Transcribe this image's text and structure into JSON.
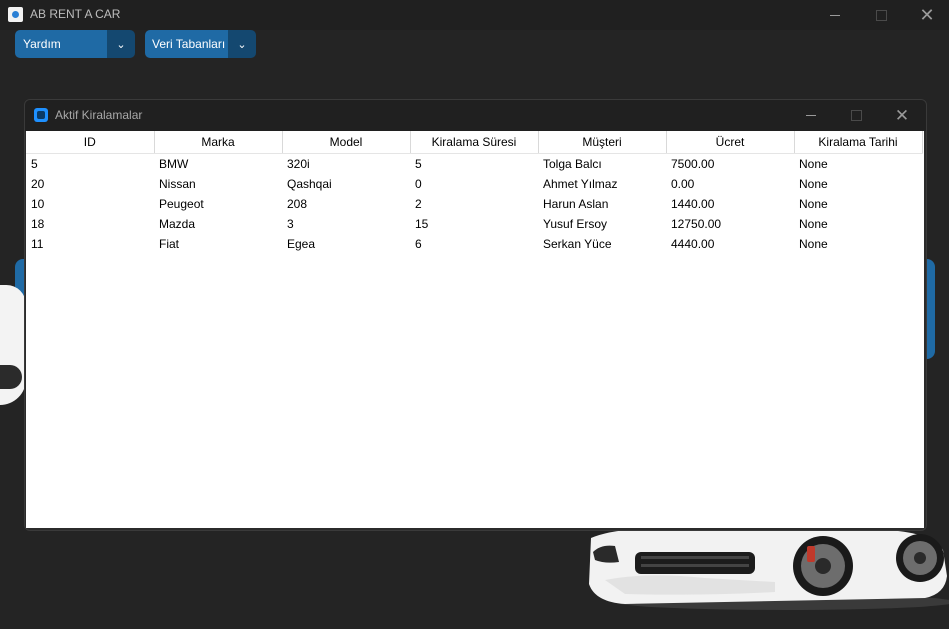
{
  "app": {
    "title": "AB RENT A CAR"
  },
  "menus": [
    {
      "label": "Yardım"
    },
    {
      "label": "Veri Tabanları"
    }
  ],
  "child_window": {
    "title": "Aktif Kiralamalar",
    "table": {
      "columns": [
        "ID",
        "Marka",
        "Model",
        "Kiralama Süresi",
        "Müşteri",
        "Ücret",
        "Kiralama Tarihi"
      ],
      "rows": [
        [
          "5",
          "BMW",
          "320i",
          "5",
          "Tolga Balcı",
          "7500.00",
          "None"
        ],
        [
          "20",
          "Nissan",
          "Qashqai",
          "0",
          "Ahmet Yılmaz",
          "0.00",
          "None"
        ],
        [
          "10",
          "Peugeot",
          "208",
          "2",
          "Harun Aslan",
          "1440.00",
          "None"
        ],
        [
          "18",
          "Mazda",
          "3",
          "15",
          "Yusuf Ersoy",
          "12750.00",
          "None"
        ],
        [
          "11",
          "Fiat",
          "Egea",
          "6",
          "Serkan Yüce",
          "4440.00",
          "None"
        ]
      ]
    }
  },
  "colors": {
    "accent": "#1f6aa5",
    "accent_dark": "#144870",
    "background": "#242424"
  }
}
